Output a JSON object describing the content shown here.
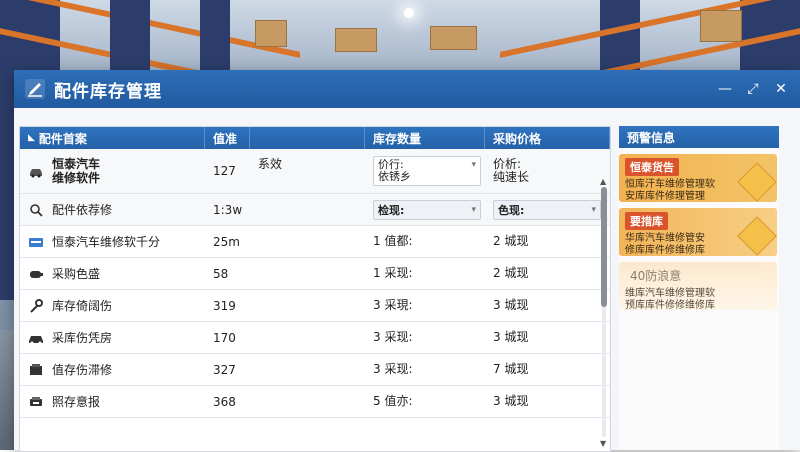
{
  "window": {
    "title": "配件库存管理",
    "controls": [
      "—",
      "⤢",
      "✕"
    ]
  },
  "table": {
    "columns": [
      "配件首案",
      "值准",
      "",
      "库存数量",
      "采购价格"
    ],
    "rows": [
      {
        "icon": "car-icon",
        "name": "恒泰汽车\n维修软件",
        "value": "127",
        "extra": "系效",
        "stock": "价行:\n依锈乡",
        "price": "价析:\n纯速长",
        "style": "tall",
        "stock_dropdown": true,
        "price_dropdown": false,
        "bold": true
      },
      {
        "icon": "search-icon",
        "name": "配件依荐修",
        "value": "1:3w",
        "extra": "",
        "stock": "检现:",
        "price": "色现:",
        "style": "sub",
        "stock_dropdown": true,
        "price_dropdown": true,
        "bold": false
      },
      {
        "icon": "card-icon",
        "name": "恒泰汽车维修软千分",
        "value": "25m",
        "extra": "",
        "stock": "1 值都:",
        "price": "2 城现",
        "style": "",
        "stock_dropdown": false,
        "price_dropdown": false,
        "bold": false
      },
      {
        "icon": "part-icon",
        "name": "采购色盛",
        "value": "58",
        "extra": "",
        "stock": "1 采现:",
        "price": "2 城现",
        "style": "",
        "stock_dropdown": false,
        "price_dropdown": false,
        "bold": false
      },
      {
        "icon": "wrench-icon",
        "name": "库存倚阔伤",
        "value": "319",
        "extra": "",
        "stock": "3 采現:",
        "price": "3 城现",
        "style": "",
        "stock_dropdown": false,
        "price_dropdown": false,
        "bold": false
      },
      {
        "icon": "vehicle-icon",
        "name": "采库伤凭房",
        "value": "170",
        "extra": "",
        "stock": "3 采现:",
        "price": "3 城现",
        "style": "",
        "stock_dropdown": false,
        "price_dropdown": false,
        "bold": false
      },
      {
        "icon": "box-icon",
        "name": "值存伤滞修",
        "value": "327",
        "extra": "",
        "stock": "3 采现:",
        "price": "7 城现",
        "style": "",
        "stock_dropdown": false,
        "price_dropdown": false,
        "bold": false
      },
      {
        "icon": "cart-icon",
        "name": "照存意报",
        "value": "368",
        "extra": "",
        "stock": "5 值亦:",
        "price": "3 城现",
        "style": "",
        "stock_dropdown": false,
        "price_dropdown": false,
        "bold": false
      }
    ]
  },
  "alerts": {
    "header": "预警信息",
    "cards": [
      {
        "title": "恒泰货告",
        "body": "恒库汗车维修管理软\n安库库件修理管理",
        "variant": "c1"
      },
      {
        "title": "要措库",
        "body": "华库汽车维修管安\n修库库件修维修库",
        "variant": "c2"
      },
      {
        "title": "40防浪意",
        "body": "维库汽车维修管理软\n预库库件修修维修库",
        "variant": "c3"
      }
    ]
  }
}
